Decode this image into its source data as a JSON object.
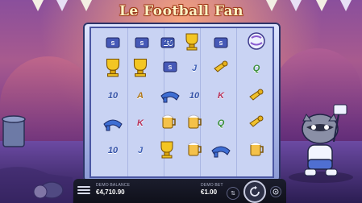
{
  "game": {
    "logo": "Le Football Fan"
  },
  "reels": {
    "rows": [
      [
        "ticket-symbol",
        "ticket-symbol",
        "10",
        "trophy-symbol",
        "ball-symbol"
      ],
      [
        "trophy-symbol",
        "trophy-symbol",
        "ticket-symbol",
        "J",
        "whistle-symbol",
        "Q"
      ],
      [
        "10",
        "A",
        "scarf-symbol",
        "10",
        "K",
        "whistle-symbol"
      ],
      [
        "scarf-symbol",
        "K",
        "beer-symbol",
        "beer-symbol",
        "Q",
        "whistle-symbol"
      ],
      [
        "10",
        "J",
        "trophy-symbol",
        "beer-symbol",
        "scarf-symbol",
        "beer-symbol"
      ]
    ],
    "labels": {
      "ten": "10",
      "j": "J",
      "q": "Q",
      "k": "K",
      "a": "A"
    }
  },
  "bottom_bar": {
    "balance_label": "DEMO BALANCE",
    "balance_value": "€4,710.90",
    "bet_label": "DEMO BET",
    "bet_value": "€1.00"
  },
  "colors": {
    "reel_bg": "#c9d3f3",
    "frame": "#8b9ad6",
    "bar": "#12131f"
  }
}
